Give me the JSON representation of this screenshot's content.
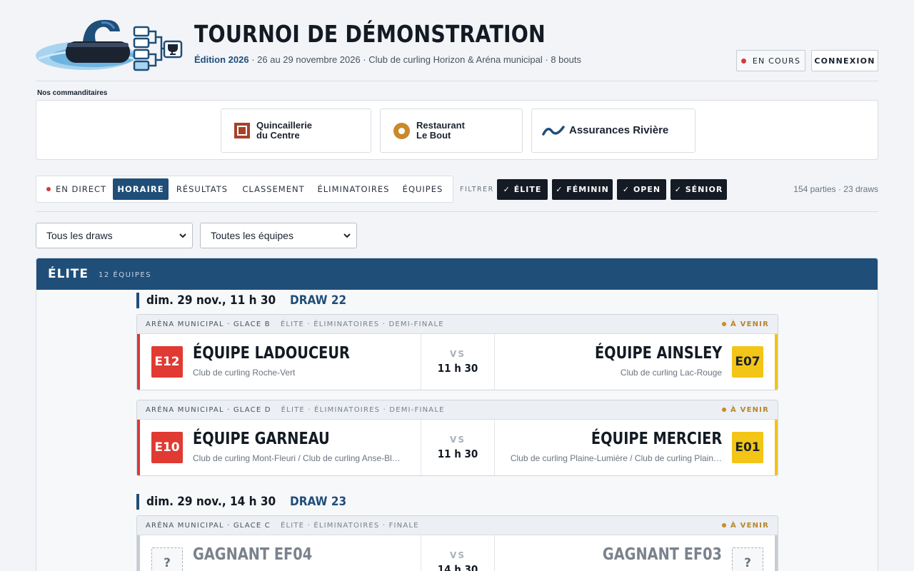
{
  "header": {
    "title": "TOURNOI DE DÉMONSTRATION",
    "edition": "Édition 2026",
    "details": "· 26 au 29 novembre 2026 · Club de curling Horizon & Aréna municipal · 8 bouts",
    "live_label": "EN COURS",
    "login_label": "CONNEXION"
  },
  "sponsors": {
    "label": "Nos commanditaires",
    "items": [
      {
        "line1": "Quincaillerie",
        "line2": "du Centre"
      },
      {
        "line1": "Restaurant",
        "line2": "Le Bout"
      },
      {
        "line1": "Assurances Rivière",
        "line2": ""
      }
    ]
  },
  "nav": {
    "tabs": [
      "EN DIRECT",
      "HORAIRE",
      "RÉSULTATS",
      "CLASSEMENT",
      "ÉLIMINATOIRES",
      "ÉQUIPES"
    ],
    "filter_label": "FILTRER",
    "filters": [
      "✓ ÉLITE",
      "✓ FÉMININ",
      "✓ OPEN",
      "✓ SÉNIOR"
    ],
    "stats": "154 parties · 23 draws"
  },
  "selects": {
    "draws": "Tous les draws",
    "teams": "Toutes les équipes"
  },
  "section": {
    "title": "ÉLITE",
    "count": "12 ÉQUIPES"
  },
  "draws": [
    {
      "when": "dim. 29 nov., 11 h 30",
      "num": "DRAW 22"
    },
    {
      "when": "dim. 29 nov., 14 h 30",
      "num": "DRAW 23"
    }
  ],
  "games": [
    {
      "venue": "ARÉNA MUNICIPAL · GLACE B",
      "category": "ÉLITE · ÉLIMINATOIRES · DEMI-FINALE",
      "status": "À VENIR",
      "left": {
        "seed": "E12",
        "name": "ÉQUIPE LADOUCEUR",
        "club": "Club de curling Roche-Vert"
      },
      "right": {
        "seed": "E07",
        "name": "ÉQUIPE AINSLEY",
        "club": "Club de curling Lac-Rouge"
      },
      "vs": "VS",
      "time": "11 h 30"
    },
    {
      "venue": "ARÉNA MUNICIPAL · GLACE D",
      "category": "ÉLITE · ÉLIMINATOIRES · DEMI-FINALE",
      "status": "À VENIR",
      "left": {
        "seed": "E10",
        "name": "ÉQUIPE GARNEAU",
        "club": "Club de curling Mont-Fleuri / Club de curling Anse-Bl…"
      },
      "right": {
        "seed": "E01",
        "name": "ÉQUIPE MERCIER",
        "club": "Club de curling Plaine-Lumière / Club de curling Plain…"
      },
      "vs": "VS",
      "time": "11 h 30"
    },
    {
      "venue": "ARÉNA MUNICIPAL · GLACE C",
      "category": "ÉLITE · ÉLIMINATOIRES · FINALE",
      "status": "À VENIR",
      "left": {
        "seed": "?",
        "name": "GAGNANT EF04",
        "club": ""
      },
      "right": {
        "seed": "?",
        "name": "GAGNANT EF03",
        "club": ""
      },
      "vs": "VS",
      "time": "14 h 30"
    }
  ]
}
